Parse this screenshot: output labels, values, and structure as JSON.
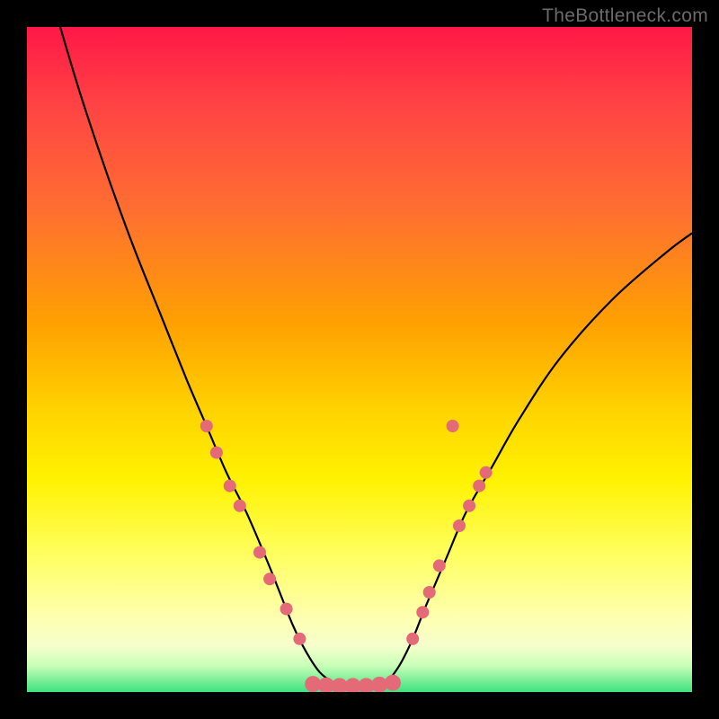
{
  "watermark": "TheBottleneck.com",
  "chart_data": {
    "type": "line",
    "title": "",
    "xlabel": "",
    "ylabel": "",
    "xlim": [
      0,
      100
    ],
    "ylim": [
      0,
      100
    ],
    "gradient_stops": [
      {
        "pct": 0,
        "color": "#ff1846"
      },
      {
        "pct": 12,
        "color": "#ff4444"
      },
      {
        "pct": 28,
        "color": "#ff7030"
      },
      {
        "pct": 45,
        "color": "#ffa200"
      },
      {
        "pct": 58,
        "color": "#ffd400"
      },
      {
        "pct": 68,
        "color": "#fff200"
      },
      {
        "pct": 80,
        "color": "#ffff66"
      },
      {
        "pct": 88,
        "color": "#ffffaa"
      },
      {
        "pct": 93,
        "color": "#f6ffcc"
      },
      {
        "pct": 96,
        "color": "#c9ffb8"
      },
      {
        "pct": 100,
        "color": "#3ee27e"
      }
    ],
    "series": [
      {
        "name": "curve",
        "x": [
          5,
          8,
          12,
          16,
          20,
          24,
          27,
          30,
          33,
          36,
          38,
          40,
          42,
          44,
          46,
          48,
          50,
          52,
          54,
          56,
          58,
          60,
          63,
          66,
          70,
          74,
          80,
          88,
          96,
          100
        ],
        "y": [
          100,
          90,
          78,
          67,
          57,
          47,
          40,
          33,
          27,
          20,
          15,
          10,
          6,
          3,
          1.5,
          0.8,
          0.5,
          0.8,
          1.5,
          4,
          8,
          13,
          20,
          27,
          34,
          41,
          50,
          59,
          66,
          69
        ]
      }
    ],
    "markers_left": [
      {
        "x": 27.0,
        "y": 40.0
      },
      {
        "x": 28.5,
        "y": 36.0
      },
      {
        "x": 30.5,
        "y": 31.0
      },
      {
        "x": 32.0,
        "y": 28.0
      },
      {
        "x": 35.0,
        "y": 21.0
      },
      {
        "x": 36.5,
        "y": 17.0
      },
      {
        "x": 39.0,
        "y": 12.5
      },
      {
        "x": 41.0,
        "y": 8.0
      }
    ],
    "markers_bottom": [
      {
        "x": 43.0,
        "y": 1.2
      },
      {
        "x": 45.0,
        "y": 1.0
      },
      {
        "x": 47.0,
        "y": 0.9
      },
      {
        "x": 49.0,
        "y": 0.9
      },
      {
        "x": 51.0,
        "y": 0.9
      },
      {
        "x": 53.0,
        "y": 1.1
      },
      {
        "x": 55.0,
        "y": 1.4
      }
    ],
    "markers_right": [
      {
        "x": 58.0,
        "y": 8.0
      },
      {
        "x": 59.5,
        "y": 12.0
      },
      {
        "x": 60.5,
        "y": 15.0
      },
      {
        "x": 62.0,
        "y": 19.0
      },
      {
        "x": 65.0,
        "y": 25.0
      },
      {
        "x": 66.5,
        "y": 28.0
      },
      {
        "x": 68.0,
        "y": 31.0
      },
      {
        "x": 69.0,
        "y": 33.0
      },
      {
        "x": 64.0,
        "y": 40.0
      }
    ],
    "marker_color": "#e46a77",
    "curve_color": "#000000"
  }
}
